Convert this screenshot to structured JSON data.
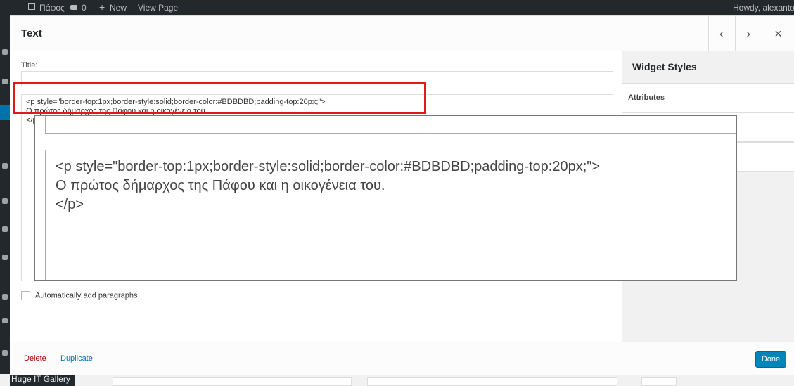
{
  "adminbar": {
    "site_name": "Πάφος",
    "comments_count": "0",
    "new_label": "New",
    "view_page_label": "View Page",
    "howdy": "Howdy, alexantor"
  },
  "admin_menu": {
    "gallery_label": "Huge IT Gallery"
  },
  "dialog": {
    "title": "Text",
    "prev_label": "‹",
    "next_label": "›",
    "close_label": "×",
    "title_field_label": "Title:",
    "title_value": "",
    "content_lines": [
      "<p style=\"border-top:1px;border-style:solid;border-color:#BDBDBD;padding-top:20px;\">",
      "Ο πρώτος δήμαρχος της Πάφου και η οικογένεια του.",
      "</p>"
    ],
    "autop_label": "Automatically add paragraphs",
    "delete_label": "Delete",
    "duplicate_label": "Duplicate",
    "done_label": "Done"
  },
  "sidebar": {
    "heading": "Widget Styles",
    "sections": [
      "Attributes",
      "",
      ""
    ]
  },
  "colors": {
    "highlight": "#e0191b",
    "primary": "#0085ba",
    "delete": "#aa0000",
    "link": "#0073aa"
  }
}
